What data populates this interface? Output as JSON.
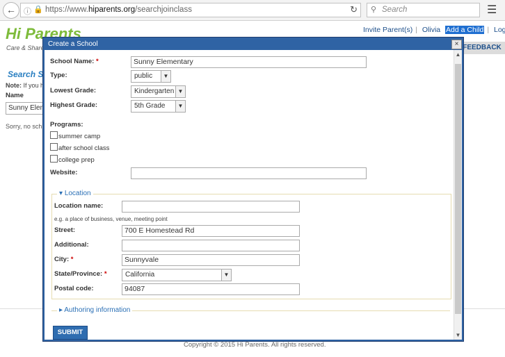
{
  "browser": {
    "url_prefix": "https://www.",
    "url_domain": "hiparents.org",
    "url_path": "/searchjoinclass",
    "search_placeholder": "Search"
  },
  "page": {
    "logo": "Hi Parents",
    "tagline": "Care & Share",
    "top_links": [
      "Invite Parent(s)",
      "Olivia",
      "Add a Child",
      "Logout"
    ],
    "feedback": "FEEDBACK",
    "search_title": "Search S",
    "note_label": "Note:",
    "note_text": "If you h",
    "name_label": "Name",
    "name_value": "Sunny Elem",
    "sorry": "Sorry, no sch",
    "copyright": "Copyright © 2015 Hi Parents. All rights reserved."
  },
  "modal": {
    "title": "Create a School",
    "close": "×",
    "school_name_label": "School Name:",
    "school_name_value": "Sunny Elementary",
    "type_label": "Type:",
    "type_value": "public",
    "lowest_label": "Lowest Grade:",
    "lowest_value": "Kindergarten",
    "highest_label": "Highest Grade:",
    "highest_value": "5th Grade",
    "programs_label": "Programs:",
    "programs": [
      "summer camp",
      "after school class",
      "college prep"
    ],
    "website_label": "Website:",
    "website_value": "",
    "location_legend": "Location",
    "location_name_label": "Location name:",
    "location_name_value": "",
    "location_hint": "e.g. a place of business, venue, meeting point",
    "street_label": "Street:",
    "street_value": "700 E Homestead Rd",
    "additional_label": "Additional:",
    "additional_value": "",
    "city_label": "City:",
    "city_value": "Sunnyvale",
    "state_label": "State/Province:",
    "state_value": "California",
    "postal_label": "Postal code:",
    "postal_value": "94087",
    "authoring": "Authoring information",
    "submit": "SUBMIT",
    "required_mark": "*"
  }
}
